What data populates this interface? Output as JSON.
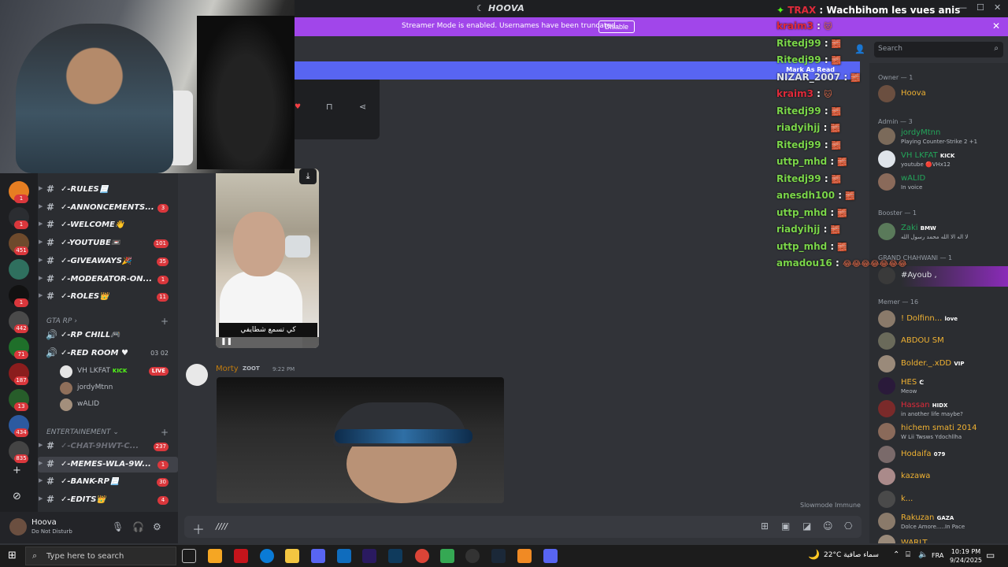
{
  "window": {
    "title": "HOOVA",
    "controls": [
      "—",
      "☐",
      "✕"
    ]
  },
  "banner": {
    "message": "Streamer Mode is enabled. Usernames have been truncated.",
    "disable_label": "Disable",
    "color": "#a146ea"
  },
  "unread_bar": {
    "label": "Mark As Read"
  },
  "servers": [
    {
      "badge": "1"
    },
    {
      "badge": "1"
    },
    {
      "badge": "451"
    },
    {
      "badge": ""
    },
    {
      "badge": "1"
    },
    {
      "badge": "442"
    },
    {
      "badge": "71"
    },
    {
      "badge": "187"
    },
    {
      "badge": "13"
    },
    {
      "badge": "434"
    },
    {
      "badge": "835"
    }
  ],
  "channels": [
    {
      "name": "✓-RULES📃",
      "badge": "",
      "dim": false,
      "active": false
    },
    {
      "name": "✓-ANNONCEMENTS...",
      "badge": "3",
      "dim": false,
      "active": false
    },
    {
      "name": "✓-WELCOME👋",
      "badge": "",
      "dim": false,
      "active": false
    },
    {
      "name": "✓-YOUTUBE📼",
      "badge": "101",
      "dim": false,
      "active": false
    },
    {
      "name": "✓-GIVEAWAYS🎉",
      "badge": "35",
      "dim": false,
      "active": false
    },
    {
      "name": "✓-MODERATOR-ON...",
      "badge": "1",
      "dim": false,
      "active": false
    },
    {
      "name": "✓-ROLES👑",
      "badge": "11",
      "dim": false,
      "active": false
    }
  ],
  "category_gta": "GTA RP",
  "voice_channels": [
    {
      "name": "✓-RP CHILL🎮",
      "count": ""
    },
    {
      "name": "✓-RED ROOM ♥",
      "count": "03 02"
    }
  ],
  "voice_users": [
    {
      "name": "VH LKFAT",
      "tag": "KICK",
      "live": "LIVE"
    },
    {
      "name": "jordyMtnn",
      "tag": "",
      "live": ""
    },
    {
      "name": "wALID",
      "tag": "",
      "live": ""
    }
  ],
  "category_ent": "ENTERTAINEMENT",
  "channels_ent": [
    {
      "name": "✓-CHAT-9HWT-C...",
      "badge": "237",
      "dim": true,
      "active": false
    },
    {
      "name": "✓-MEMES-WLA-9W...",
      "badge": "1",
      "dim": false,
      "active": true
    },
    {
      "name": "✓-BANK-RP📃",
      "badge": "30",
      "dim": false,
      "active": false
    },
    {
      "name": "✓-EDITS👑",
      "badge": "4",
      "dim": false,
      "active": false
    }
  ],
  "user_panel": {
    "name": "Hoova",
    "status": "Do Not Disturb"
  },
  "messages": [
    {
      "author": "Morty",
      "tag": "ZOOT",
      "time": "9:22 PM"
    }
  ],
  "video1_caption": "كي تسمع شطايفي",
  "slowmode": "Slowmode Immune",
  "composer": {
    "text": "////"
  },
  "search": {
    "placeholder": "Search"
  },
  "overlay_top": {
    "user": "TRAX",
    "text": "Wachbihom les vues anis"
  },
  "overlay": [
    {
      "user": "kraim3",
      "emotes": "🐱",
      "style": "red"
    },
    {
      "user": "Ritedj99",
      "emotes": "🧱",
      "style": "green"
    },
    {
      "user": "Ritedj99",
      "emotes": "🧱",
      "style": "green"
    },
    {
      "user": "NIZAR_2007",
      "emotes": "🧱",
      "style": "white"
    },
    {
      "user": "kraim3",
      "emotes": "🐱",
      "style": "red"
    },
    {
      "user": "Ritedj99",
      "emotes": "🧱",
      "style": "green"
    },
    {
      "user": "riadyihjj",
      "emotes": "🧱",
      "style": "green"
    },
    {
      "user": "Ritedj99",
      "emotes": "🧱",
      "style": "green"
    },
    {
      "user": "uttp_mhd",
      "emotes": "🧱",
      "style": "green"
    },
    {
      "user": "Ritedj99",
      "emotes": "🧱",
      "style": "green"
    },
    {
      "user": "anesdh100",
      "emotes": "🧱",
      "style": "green"
    },
    {
      "user": "uttp_mhd",
      "emotes": "🧱",
      "style": "green"
    },
    {
      "user": "riadyihjj",
      "emotes": "🧱",
      "style": "green"
    },
    {
      "user": "uttp_mhd",
      "emotes": "🧱",
      "style": "green"
    },
    {
      "user": "amadou16",
      "emotes": "😂😂😂😂😂😂😂",
      "style": "green"
    }
  ],
  "member_groups": {
    "owner": "Owner — 1",
    "admin": "Admin — 3",
    "booster": "Booster — 1",
    "grand": "GRAND CHAHWANI — 1",
    "memer": "Memer — 16"
  },
  "members": [
    {
      "name": "Hoova",
      "sub": "",
      "tag": "",
      "color": "#f0b232"
    },
    {
      "name": "jordyMtnn",
      "sub": "Playing Counter-Strike 2 +1",
      "tag": "",
      "color": "#23a55a"
    },
    {
      "name": "VH LKFAT",
      "sub": "youtube 🔴VHx12",
      "tag": "KICK",
      "color": "#23a55a"
    },
    {
      "name": "wALID",
      "sub": "In voice",
      "tag": "",
      "color": "#23a55a"
    },
    {
      "name": "Zaki",
      "sub": "لا اله الا الله محمد رسول الله",
      "tag": "BMW",
      "color": "#23a55a"
    },
    {
      "name": "#Ayoub ,",
      "sub": "",
      "tag": "",
      "color": "#dbdee1"
    },
    {
      "name": "! Dolfinn...",
      "sub": "",
      "tag": "love",
      "color": "#f0b232"
    },
    {
      "name": "ABDOU SM",
      "sub": "",
      "tag": "",
      "color": "#f0b232"
    },
    {
      "name": "Bolder._.xDD",
      "sub": "",
      "tag": "VIP",
      "color": "#f0b232"
    },
    {
      "name": "HES",
      "sub": "Meow",
      "tag": "ᕦ",
      "color": "#f0b232"
    },
    {
      "name": "Hassan",
      "sub": "in another life maybe?",
      "tag": "HIDX",
      "color": "#e02a3a"
    },
    {
      "name": "hichem smati 2014",
      "sub": "W Lii Twsws Ydochllha",
      "tag": "",
      "color": "#f0b232"
    },
    {
      "name": "Hodaifa",
      "sub": "",
      "tag": "079",
      "color": "#f0b232"
    },
    {
      "name": "kazawa",
      "sub": "",
      "tag": "",
      "color": "#f0b232"
    },
    {
      "name": "k...",
      "sub": "",
      "tag": "",
      "color": "#f0b232"
    },
    {
      "name": "Rakuzan",
      "sub": "Dolce Amore.....In Pace",
      "tag": "GAZA",
      "color": "#f0b232"
    },
    {
      "name": "WARLT",
      "sub": "",
      "tag": "",
      "color": "#f0b232"
    }
  ],
  "taskbar": {
    "search_placeholder": "Type here to search",
    "weather": "22°C  سماء صافية",
    "lang": "FRA",
    "time": "10:19 PM",
    "date": "9/24/2025"
  }
}
